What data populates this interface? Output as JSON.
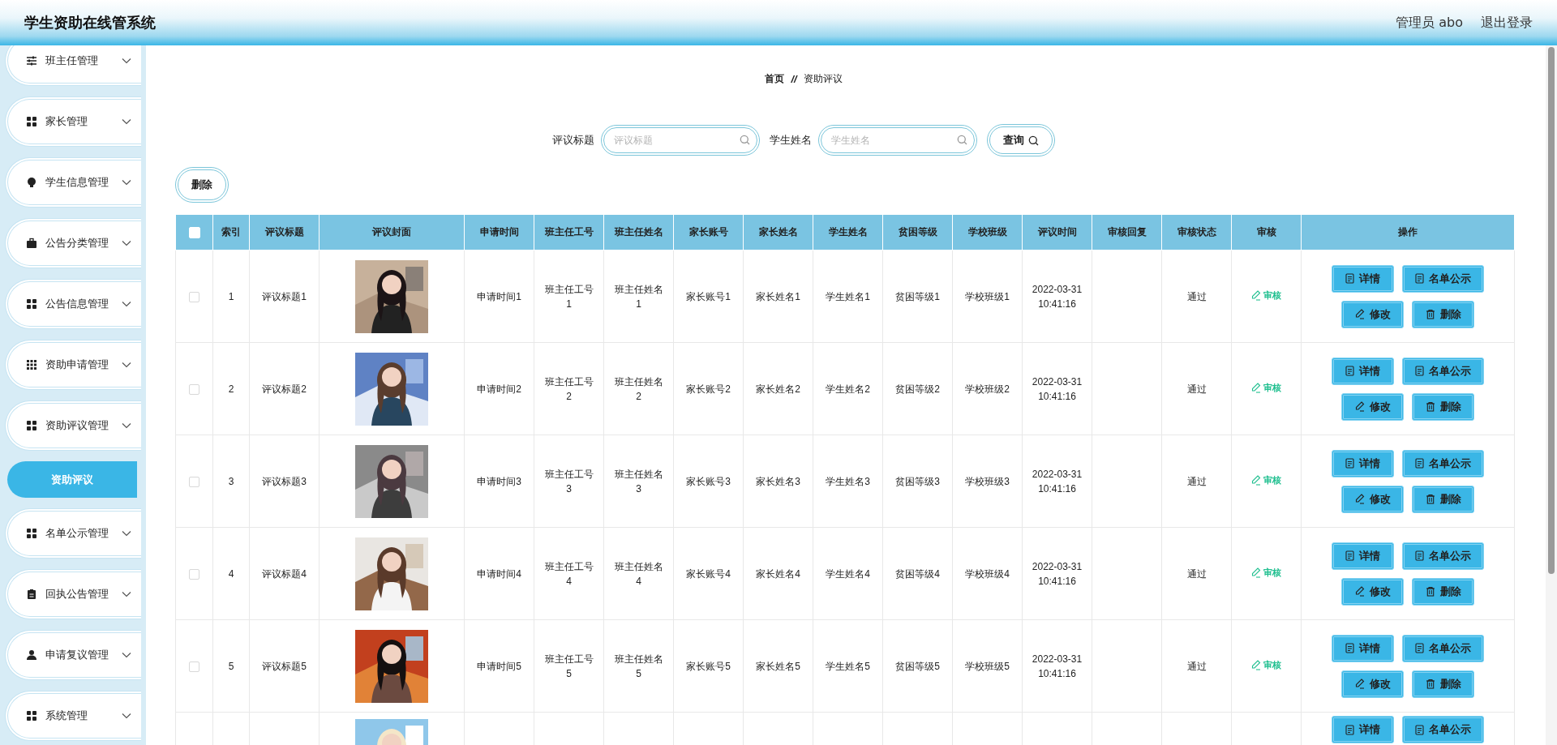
{
  "header": {
    "title": "学生资助在线管系统",
    "user": "管理员 abo",
    "logout": "退出登录"
  },
  "sidebar": {
    "items": [
      {
        "label": "班主任管理"
      },
      {
        "label": "家长管理"
      },
      {
        "label": "学生信息管理"
      },
      {
        "label": "公告分类管理"
      },
      {
        "label": "公告信息管理"
      },
      {
        "label": "资助申请管理"
      },
      {
        "label": "资助评议管理",
        "children": [
          {
            "label": "资助评议",
            "selected": true
          }
        ]
      },
      {
        "label": "名单公示管理"
      },
      {
        "label": "回执公告管理"
      },
      {
        "label": "申请复议管理"
      },
      {
        "label": "系统管理"
      }
    ]
  },
  "breadcrumb": {
    "items": [
      "首页",
      "资助评议"
    ],
    "separator": "//"
  },
  "search": {
    "fields": [
      {
        "label": "评议标题",
        "placeholder": "评议标题"
      },
      {
        "label": "学生姓名",
        "placeholder": "学生姓名"
      }
    ],
    "button": "查询"
  },
  "delete_button": "删除",
  "table": {
    "header_checked": false,
    "columns": [
      "索引",
      "评议标题",
      "评议封面",
      "申请时间",
      "班主任工号",
      "班主任姓名",
      "家长账号",
      "家长姓名",
      "学生姓名",
      "贫困等级",
      "学校班级",
      "评议时间",
      "审核回复",
      "审核状态",
      "审核",
      "操作"
    ],
    "rows": [
      {
        "checked": false,
        "cells": [
          "1",
          "评议标题1",
          null,
          "申请时间1",
          "班主任工号1",
          "班主任姓名1",
          "家长账号1",
          "家长姓名1",
          "学生姓名1",
          "贫困等级1",
          "学校班级1",
          "2022-03-31 10:41:16",
          null,
          "通过"
        ],
        "review": "审核",
        "actions": [
          {
            "kind": "detail",
            "label": "详情"
          },
          {
            "kind": "publish",
            "label": "名单公示"
          },
          {
            "kind": "edit",
            "label": "修改"
          },
          {
            "kind": "delete",
            "label": "删除"
          }
        ]
      },
      {
        "checked": false,
        "cells": [
          "2",
          "评议标题2",
          null,
          "申请时间2",
          "班主任工号2",
          "班主任姓名2",
          "家长账号2",
          "家长姓名2",
          "学生姓名2",
          "贫困等级2",
          "学校班级2",
          "2022-03-31 10:41:16",
          null,
          "通过"
        ],
        "review": "审核",
        "actions": [
          {
            "kind": "detail",
            "label": "详情"
          },
          {
            "kind": "publish",
            "label": "名单公示"
          },
          {
            "kind": "edit",
            "label": "修改"
          },
          {
            "kind": "delete",
            "label": "删除"
          }
        ]
      },
      {
        "checked": false,
        "cells": [
          "3",
          "评议标题3",
          null,
          "申请时间3",
          "班主任工号3",
          "班主任姓名3",
          "家长账号3",
          "家长姓名3",
          "学生姓名3",
          "贫困等级3",
          "学校班级3",
          "2022-03-31 10:41:16",
          null,
          "通过"
        ],
        "review": "审核",
        "actions": [
          {
            "kind": "detail",
            "label": "详情"
          },
          {
            "kind": "publish",
            "label": "名单公示"
          },
          {
            "kind": "edit",
            "label": "修改"
          },
          {
            "kind": "delete",
            "label": "删除"
          }
        ]
      },
      {
        "checked": false,
        "cells": [
          "4",
          "评议标题4",
          null,
          "申请时间4",
          "班主任工号4",
          "班主任姓名4",
          "家长账号4",
          "家长姓名4",
          "学生姓名4",
          "贫困等级4",
          "学校班级4",
          "2022-03-31 10:41:16",
          null,
          "通过"
        ],
        "review": "审核",
        "actions": [
          {
            "kind": "detail",
            "label": "详情"
          },
          {
            "kind": "publish",
            "label": "名单公示"
          },
          {
            "kind": "edit",
            "label": "修改"
          },
          {
            "kind": "delete",
            "label": "删除"
          }
        ]
      },
      {
        "checked": false,
        "cells": [
          "5",
          "评议标题5",
          null,
          "申请时间5",
          "班主任工号5",
          "班主任姓名5",
          "家长账号5",
          "家长姓名5",
          "学生姓名5",
          "贫困等级5",
          "学校班级5",
          "2022-03-31 10:41:16",
          null,
          "通过"
        ],
        "review": "审核",
        "actions": [
          {
            "kind": "detail",
            "label": "详情"
          },
          {
            "kind": "publish",
            "label": "名单公示"
          },
          {
            "kind": "edit",
            "label": "修改"
          },
          {
            "kind": "delete",
            "label": "删除"
          }
        ]
      },
      {
        "actions": [
          {
            "kind": "detail",
            "label": "详情"
          },
          {
            "kind": "publish",
            "label": "名单公示"
          }
        ]
      }
    ]
  }
}
